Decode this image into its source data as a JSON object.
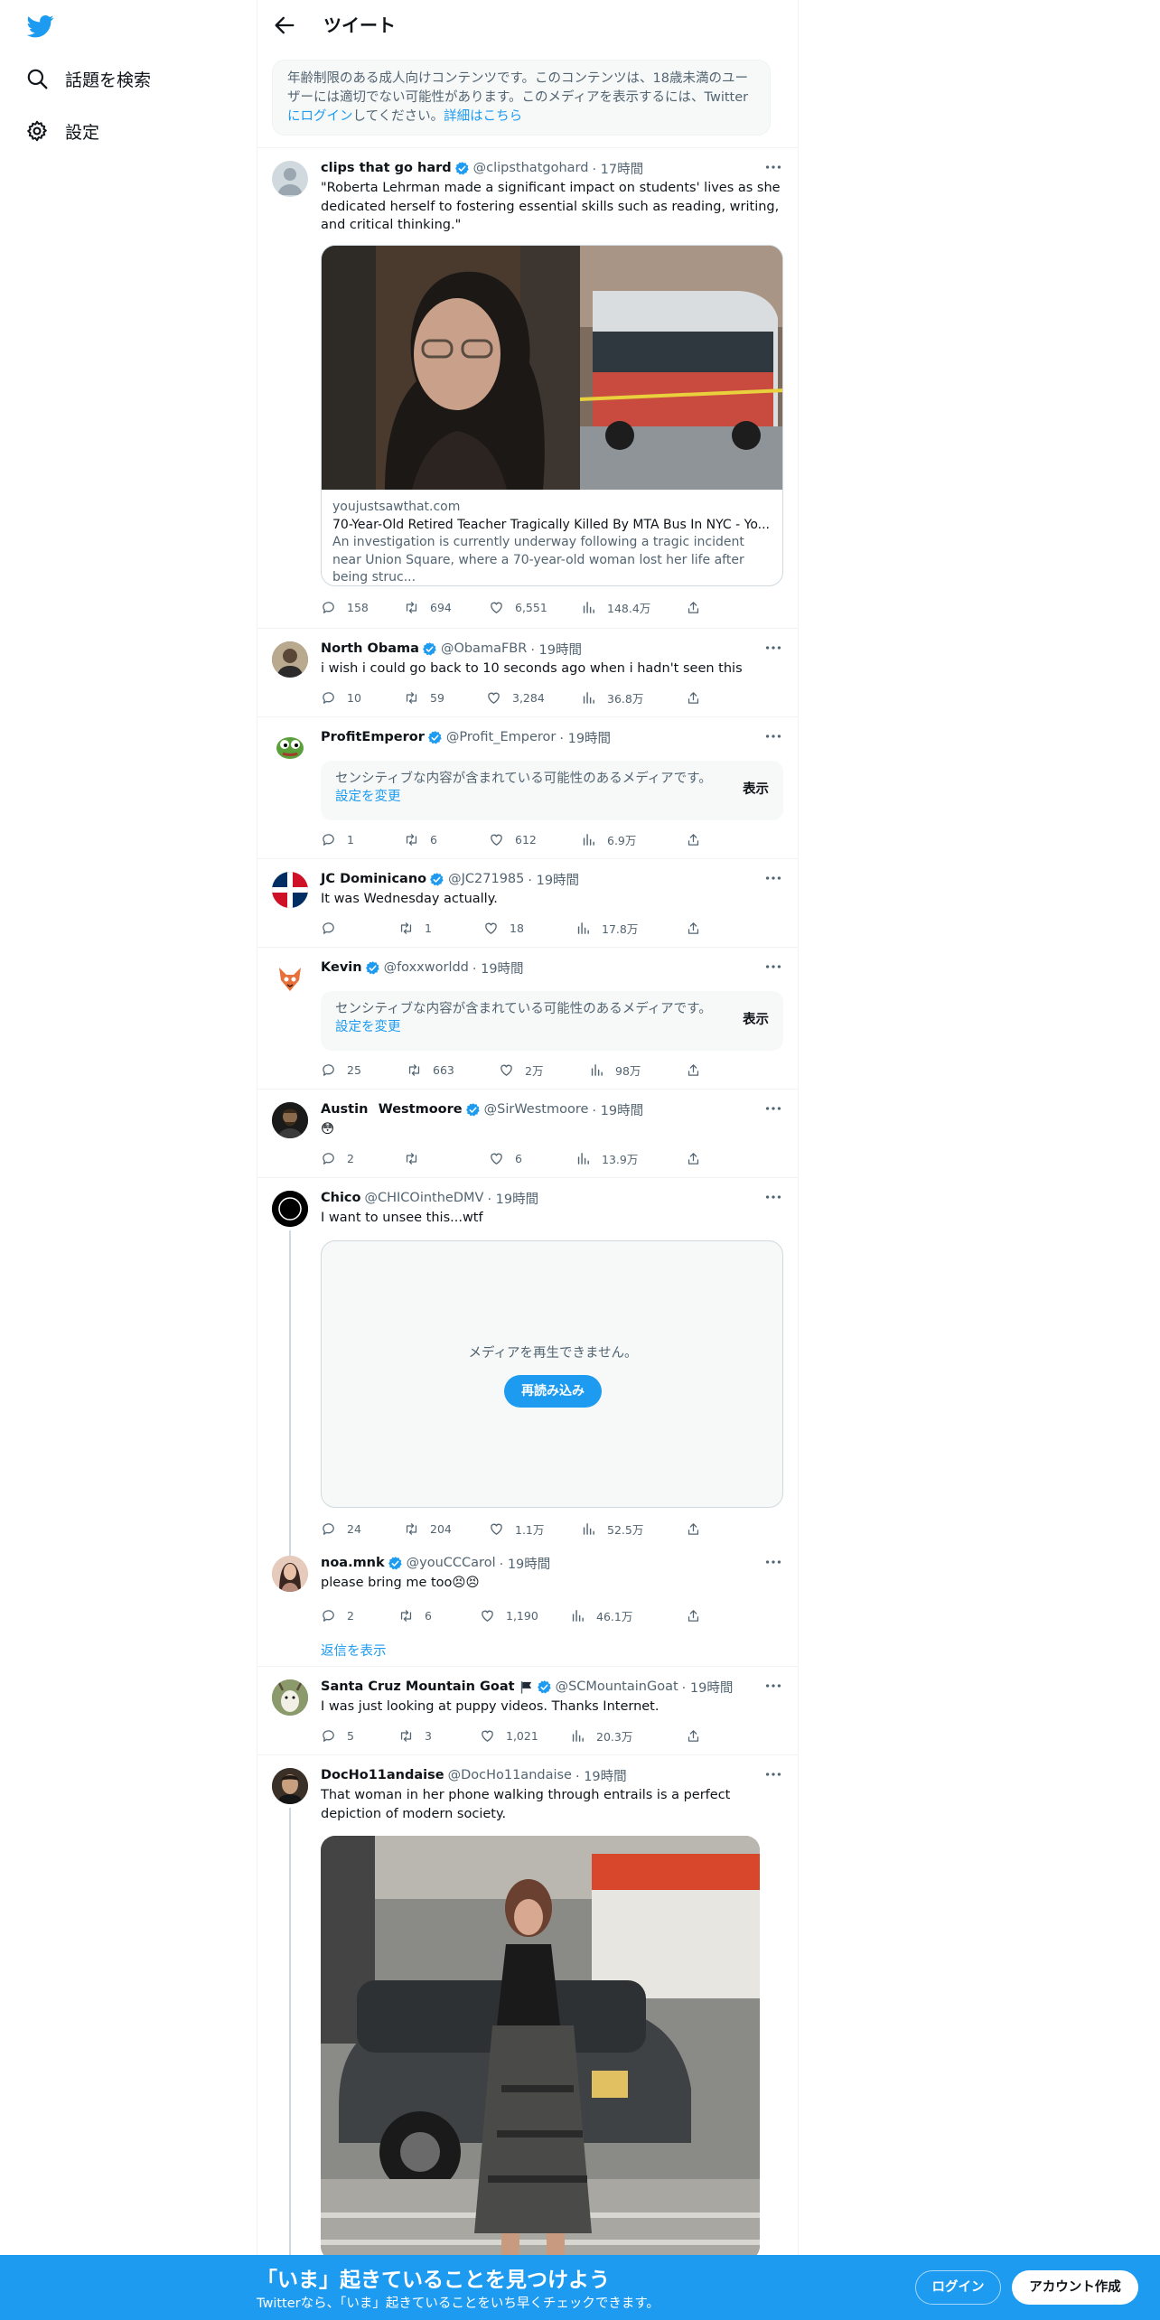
{
  "colors": {
    "accent": "#1d9bf0",
    "text": "#0f1419",
    "muted": "#536471",
    "border": "#cfd9de"
  },
  "sidebar": {
    "logo": "twitter-bird-icon",
    "items": [
      {
        "label": "話題を検索",
        "icon": "search-icon"
      },
      {
        "label": "設定",
        "icon": "gear-icon"
      }
    ]
  },
  "header": {
    "title": "ツイート"
  },
  "notice": {
    "text": "年齢制限のある成人向けコンテンツです。このコンテンツは、18歳未満のユーザーには適切でない可能性があります。このメディアを表示するには、Twitter",
    "login_link": "にログイン",
    "text2": "してください。",
    "details_link": "詳細はこちら"
  },
  "tweets": [
    {
      "name": "clips that go hard",
      "handle": "@clipsthatgohard",
      "time": "· 17時間",
      "text": "\"Roberta Lehrman made a significant impact on students' lives as she dedicated herself to fostering essential skills such as reading, writing, and critical thinking.\"",
      "card": {
        "domain": "youjustsawthat.com",
        "title": "70-Year-Old Retired Teacher Tragically Killed By MTA Bus In NYC - Yo...",
        "desc": "An investigation is currently underway following a tragic incident near Union Square, where a 70-year-old woman lost her life after being struc..."
      },
      "replies": "158",
      "retweets": "694",
      "likes": "6,551",
      "views": "148.4万"
    },
    {
      "name": "North Obama",
      "handle": "@ObamaFBR",
      "time": "· 19時間",
      "text": "i wish i could go back to 10 seconds ago when i hadn't seen this",
      "replies": "10",
      "retweets": "59",
      "likes": "3,284",
      "views": "36.8万"
    },
    {
      "name": "ProfitEmperor",
      "handle": "@Profit_Emperor",
      "time": "· 19時間",
      "sensitive": {
        "text": "センシティブな内容が含まれている可能性のあるメディアです。",
        "link": "設定を変更",
        "button": "表示"
      },
      "replies": "1",
      "retweets": "6",
      "likes": "612",
      "views": "6.9万"
    },
    {
      "name": "JC Dominicano",
      "handle": "@JC271985",
      "time": "· 19時間",
      "text": "It was Wednesday actually.",
      "replies": "",
      "retweets": "1",
      "likes": "18",
      "views": "17.8万"
    },
    {
      "name": "Kevin",
      "handle": "@foxxworldd",
      "time": "· 19時間",
      "sensitive": {
        "text": "センシティブな内容が含まれている可能性のあるメディアです。",
        "link": "設定を変更",
        "button": "表示"
      },
      "replies": "25",
      "retweets": "663",
      "likes": "2万",
      "views": "98万"
    },
    {
      "name": "Austin⠀Westmoore",
      "handle": "@SirWestmoore",
      "time": "· 19時間",
      "text": "😳",
      "replies": "2",
      "retweets": "",
      "likes": "6",
      "views": "13.9万"
    },
    {
      "name": "Chico",
      "handle": "@CHICOintheDMV",
      "time": "· 19時間",
      "text": "I want to unsee this...wtf",
      "video": {
        "message": "メディアを再生できません。",
        "button": "再読み込み"
      },
      "replies": "24",
      "retweets": "204",
      "likes": "1.1万",
      "views": "52.5万"
    },
    {
      "name": "noa.mnk",
      "handle": "@youCCCarol",
      "time": "· 19時間",
      "text": "please bring me too😣😣",
      "replies": "2",
      "retweets": "6",
      "likes": "1,190",
      "views": "46.1万",
      "show_replies": "返信を表示"
    },
    {
      "name": "Santa Cruz Mountain Goat",
      "handle": "@SCMountainGoat",
      "time": "· 19時間",
      "text": "I was just looking at puppy videos. Thanks Internet.",
      "replies": "5",
      "retweets": "3",
      "likes": "1,021",
      "views": "20.3万"
    },
    {
      "name": "DocHo11andaise",
      "handle": "@DocHo11andaise",
      "time": "· 19時間",
      "text": "That woman in her phone walking through entrails is a perfect depiction of modern society."
    }
  ],
  "bottom_bar": {
    "title": "「いま」起きていることを見つけよう",
    "subtitle": "Twitterなら、「いま」起きていることをいち早くチェックできます。",
    "login": "ログイン",
    "signup": "アカウント作成"
  }
}
